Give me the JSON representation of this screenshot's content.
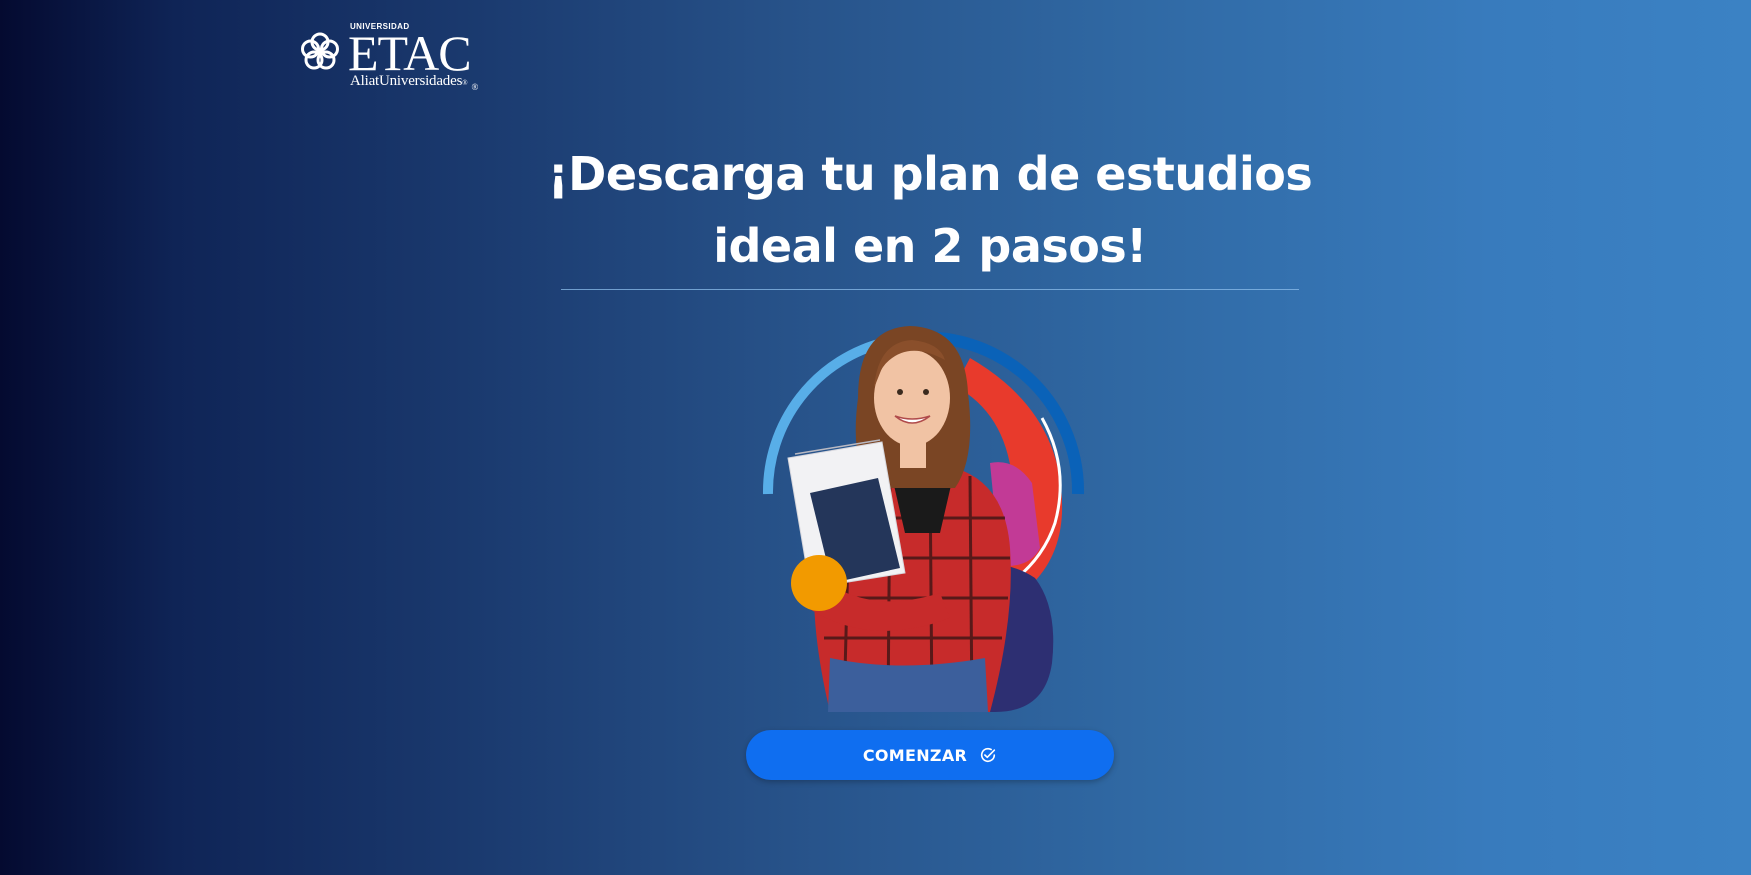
{
  "brand": {
    "prefix": "UNIVERSIDAD",
    "name": "ETAC",
    "registered": "®",
    "subtitle": "AliatUniversidades",
    "subtitle_mark": "®"
  },
  "headline": {
    "line1": "¡Descarga tu plan de estudios",
    "line2": "ideal en 2 pasos!"
  },
  "hero": {
    "icon": "student-illustration",
    "colors": {
      "arc_light": "#58aee8",
      "arc_dark": "#0a62b8",
      "accent_red": "#e83a2c",
      "accent_orange": "#f29a00"
    }
  },
  "cta": {
    "label": "COMENZAR",
    "icon": "check-circle-icon",
    "color": "#0f6ef0"
  }
}
